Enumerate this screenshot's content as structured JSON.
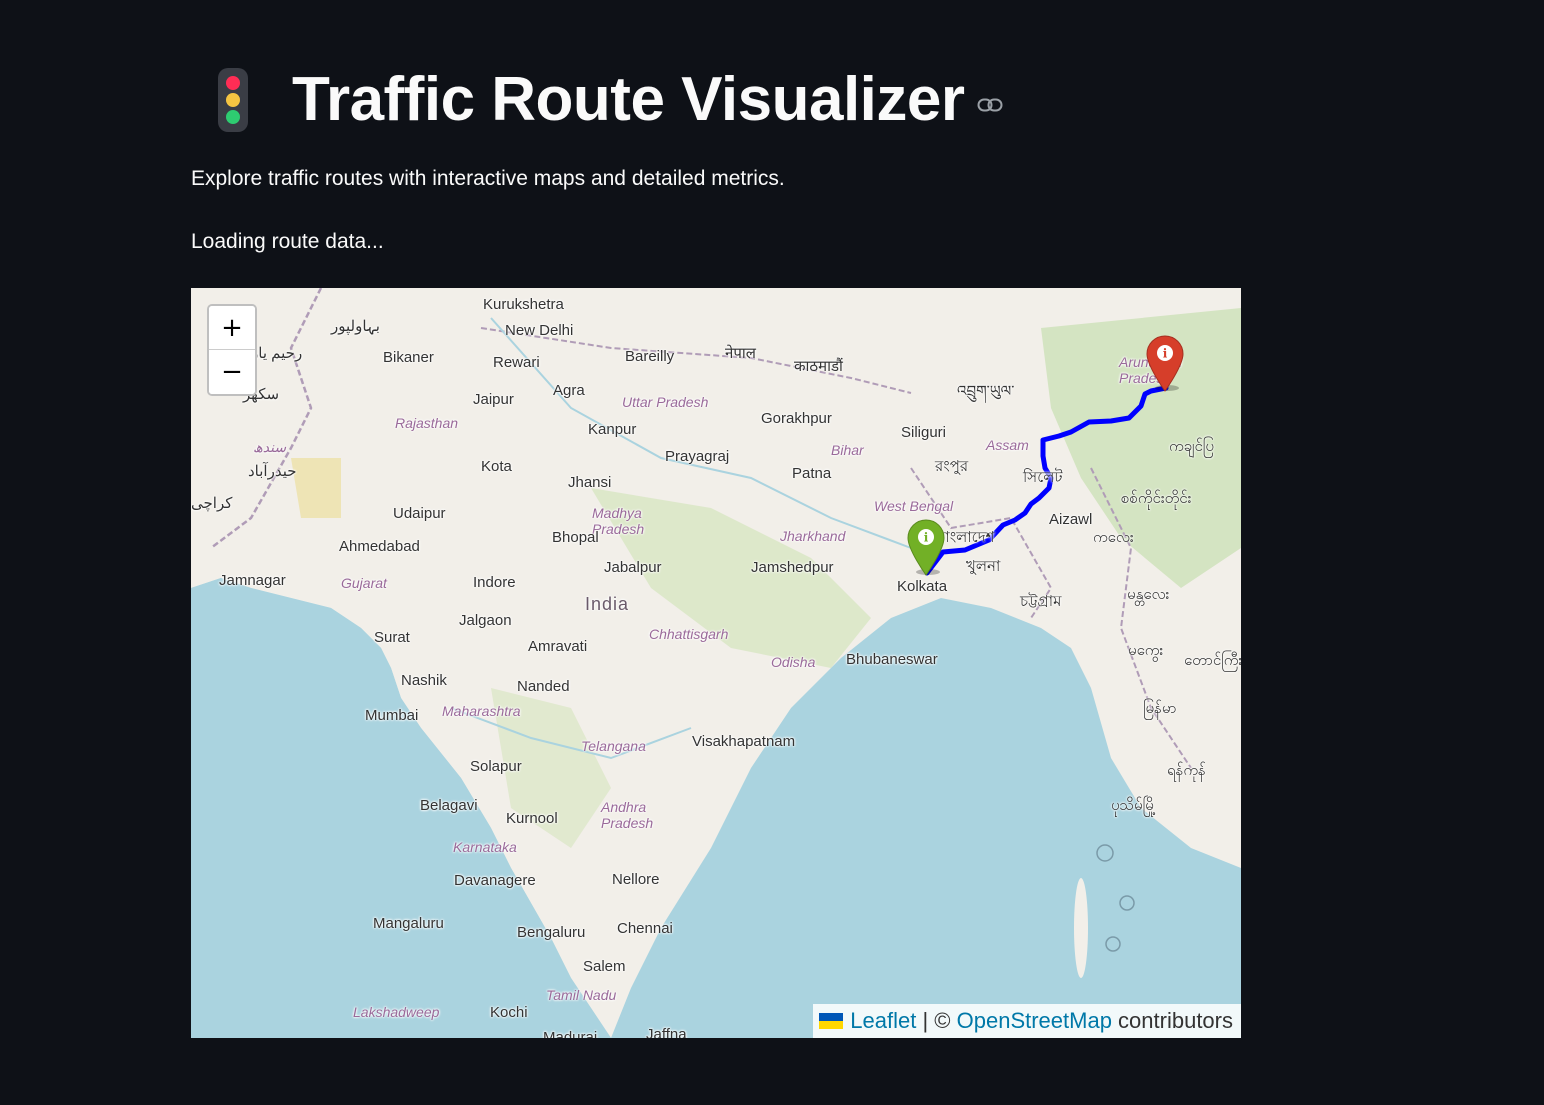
{
  "header": {
    "title": "Traffic Route Visualizer",
    "icon": "traffic-light-icon",
    "link_icon": "link-icon"
  },
  "subtitle": "Explore traffic routes with interactive maps and detailed metrics.",
  "status": "Loading route data...",
  "map": {
    "zoom_in_label": "+",
    "zoom_out_label": "−",
    "route_color": "#0000ff",
    "markers": {
      "start": {
        "color": "#72b026",
        "icon": "info-icon",
        "place": "Kolkata"
      },
      "end": {
        "color": "#d63e2a",
        "icon": "info-icon",
        "place": "Arunachal Pradesh"
      }
    },
    "labels": {
      "kurukshetra": "Kurukshetra",
      "new_delhi": "New Delhi",
      "bahawalpur": "بہاولپور",
      "rahim_yar": "رحیم یار",
      "bikaner": "Bikaner",
      "rewari": "Rewari",
      "bareilly": "Bareilly",
      "nepal": "नेपाल",
      "kathmandu": "काठमाडौं",
      "sukkur": "سکھر",
      "jaipur": "Jaipur",
      "agra": "Agra",
      "uttar_pradesh": "Uttar Pradesh",
      "bhutan": "འབྲུག་ཡུལ་",
      "arunachal": "Arunachal Pradesh",
      "rajasthan": "Rajasthan",
      "kanpur": "Kanpur",
      "gorakhpur": "Gorakhpur",
      "siliguri": "Siliguri",
      "sindh": "سندھ",
      "hyderabad_pk": "حیدرآباد",
      "assam": "Assam",
      "prayagraj": "Prayagraj",
      "bihar": "Bihar",
      "rangpur": "রংপুর",
      "myanmar_north": "ကချင်ပြ",
      "kota": "Kota",
      "patna": "Patna",
      "jhansi": "Jhansi",
      "sylhet": "সিলেট",
      "karachi": "کراچی",
      "sagaing": "စစ်ကိုင်းတိုင်း",
      "udaipur": "Udaipur",
      "west_bengal": "West Bengal",
      "madhya_pradesh": "Madhya Pradesh",
      "aizawl": "Aizawl",
      "bhopal": "Bhopal",
      "jharkhand": "Jharkhand",
      "bangladesh": "বাংলাদেশ",
      "kalay": "ကလေး",
      "ahmedabad": "Ahmedabad",
      "jamnagar": "Jamnagar",
      "gujarat": "Gujarat",
      "indore": "Indore",
      "jabalpur": "Jabalpur",
      "jamshedpur": "Jamshedpur",
      "khulna": "খুলনা",
      "kolkata": "Kolkata",
      "india": "India",
      "chattogram": "চট্টগ্রাম",
      "mandalay": "မန္တလေး",
      "surat": "Surat",
      "jalgaon": "Jalgaon",
      "chhattisgarh": "Chhattisgarh",
      "amravati": "Amravati",
      "odisha": "Odisha",
      "bhubaneswar": "Bhubaneswar",
      "magway": "မကွေး",
      "taunggyi": "တောင်ကြီး",
      "nashik": "Nashik",
      "nanded": "Nanded",
      "mumbai": "Mumbai",
      "maharashtra": "Maharashtra",
      "myanmar": "မြန်မာ",
      "telangana": "Telangana",
      "visakhapatnam": "Visakhapatnam",
      "yangon": "ရန်ကုန်",
      "solapur": "Solapur",
      "belagavi": "Belagavi",
      "andhra_pradesh": "Andhra Pradesh",
      "pathein": "ပုသိမ်မြို့",
      "kurnool": "Kurnool",
      "karnataka": "Karnataka",
      "davanagere": "Davanagere",
      "nellore": "Nellore",
      "mangaluru": "Mangaluru",
      "bengaluru": "Bengaluru",
      "chennai": "Chennai",
      "salem": "Salem",
      "tamil_nadu": "Tamil Nadu",
      "lakshadweep": "Lakshadweep",
      "kochi": "Kochi",
      "madurai": "Madurai",
      "jaffna": "Jaffna"
    },
    "attribution": {
      "leaflet": "Leaflet",
      "separator": " | © ",
      "osm": "OpenStreetMap",
      "contributors": " contributors"
    }
  }
}
